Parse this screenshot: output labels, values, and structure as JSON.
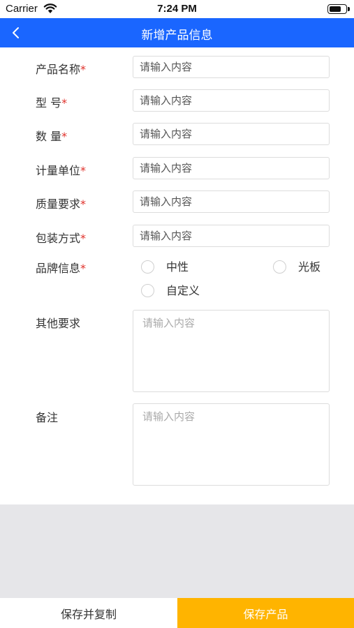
{
  "status_bar": {
    "carrier": "Carrier",
    "time": "7:24 PM",
    "battery_level": 0.75
  },
  "nav": {
    "title": "新增产品信息",
    "back_icon": "chevron-left-icon"
  },
  "form": {
    "fields": [
      {
        "label": "产品名称",
        "required_mark": "*",
        "placeholder": "请输入内容"
      },
      {
        "label": "型 号",
        "required_mark": "*",
        "placeholder": "请输入内容"
      },
      {
        "label": "数 量",
        "required_mark": "*",
        "placeholder": "请输入内容"
      },
      {
        "label": "计量单位",
        "required_mark": "*",
        "placeholder": "请输入内容"
      },
      {
        "label": "质量要求",
        "required_mark": "*",
        "placeholder": "请输入内容"
      },
      {
        "label": "包装方式",
        "required_mark": "*",
        "placeholder": "请输入内容"
      }
    ],
    "brand": {
      "label": "品牌信息",
      "required_mark": "*",
      "options": [
        "中性",
        "光板",
        "自定义"
      ]
    },
    "other": {
      "label": "其他要求",
      "placeholder": "请输入内容"
    },
    "remark": {
      "label": "备注",
      "placeholder": "请输入内容"
    }
  },
  "buttons": {
    "save_copy": "保存并复制",
    "save_product": "保存产品"
  },
  "colors": {
    "nav_bg": "#1a66ff",
    "primary_button": "#ffb400",
    "required": "#e0312b",
    "gray_area": "#e6e6e9"
  }
}
